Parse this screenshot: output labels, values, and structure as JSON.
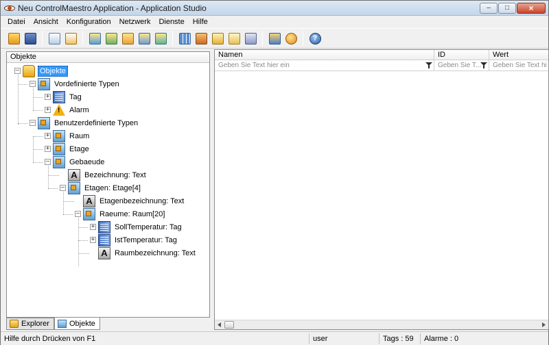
{
  "window": {
    "title": "Neu ControlMaestro Application - Application Studio"
  },
  "menu": [
    "Datei",
    "Ansicht",
    "Konfiguration",
    "Netzwerk",
    "Dienste",
    "Hilfe"
  ],
  "toolbar_icons": [
    "new-folder-icon",
    "save-icon",
    "document-icon",
    "tag-alert-icon",
    "wizard-1-icon",
    "wizard-2-icon",
    "wizard-3-icon",
    "wizard-4-icon",
    "wizard-5-icon",
    "grid-icon",
    "image-icon",
    "chart-icon",
    "sheet-icon",
    "copy-icon",
    "user-icon",
    "network-icon",
    "help-icon"
  ],
  "left_panel": {
    "header": "Objekte",
    "tree": [
      {
        "label": "Objekte",
        "icon": "database-icon",
        "level": 0,
        "expanded": true,
        "selected": true
      },
      {
        "label": "Vordefinierte Typen",
        "icon": "type-icon",
        "level": 1,
        "expanded": true
      },
      {
        "label": "Tag",
        "icon": "tag-icon",
        "level": 2,
        "expanded": false
      },
      {
        "label": "Alarm",
        "icon": "alarm-icon",
        "level": 2,
        "expanded": false
      },
      {
        "label": "Benutzerdefinierte Typen",
        "icon": "type-icon",
        "level": 1,
        "expanded": true
      },
      {
        "label": "Raum",
        "icon": "type-icon",
        "level": 2,
        "expanded": false
      },
      {
        "label": "Etage",
        "icon": "type-icon",
        "level": 2,
        "expanded": false
      },
      {
        "label": "Gebaeude",
        "icon": "type-icon",
        "level": 2,
        "expanded": true
      },
      {
        "label": "Bezeichnung: Text",
        "icon": "text-icon",
        "level": 3
      },
      {
        "label": "Etagen: Etage[4]",
        "icon": "type-icon",
        "level": 3,
        "expanded": true
      },
      {
        "label": "Etagenbezeichnung: Text",
        "icon": "text-icon",
        "level": 4
      },
      {
        "label": "Raeume: Raum[20]",
        "icon": "type-icon",
        "level": 4,
        "expanded": true
      },
      {
        "label": "SollTemperatur: Tag",
        "icon": "tag-icon",
        "level": 5,
        "expanded": false
      },
      {
        "label": "IstTemperatur: Tag",
        "icon": "tag-icon",
        "level": 5,
        "expanded": false
      },
      {
        "label": "Raumbezeichnung: Text",
        "icon": "text-icon",
        "level": 5
      }
    ]
  },
  "tabs": [
    {
      "label": "Explorer",
      "icon": "explorer-icon",
      "active": false
    },
    {
      "label": "Objekte",
      "icon": "objects-icon",
      "active": true
    }
  ],
  "grid": {
    "columns": [
      "Namen",
      "ID",
      "Wert"
    ],
    "filters": [
      "Geben Sie Text hier ein",
      "Geben Sie T...",
      "Geben Sie Text hier ein"
    ]
  },
  "status": {
    "help": "Hilfe durch Drücken von  F1",
    "user": "user",
    "tags": "Tags : 59",
    "alarms": "Alarme : 0"
  }
}
